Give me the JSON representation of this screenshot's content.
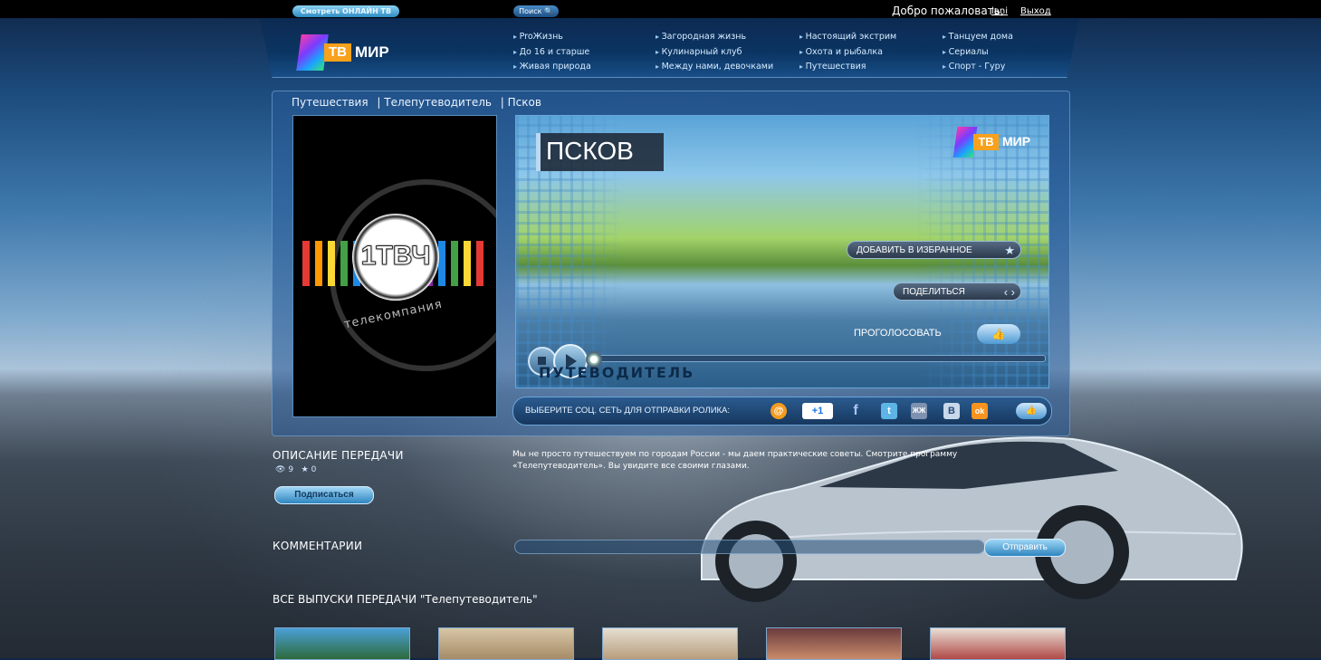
{
  "topbar": {
    "online_tv": "Смотреть ОНЛАЙН ТВ",
    "search": "Поиск 🔍",
    "welcome": "Добро пожаловать,",
    "username": "lani",
    "logout": "Выход"
  },
  "logo": {
    "tv": "ТВ",
    "mir": "МИР"
  },
  "nav": {
    "col1": [
      "ProЖизнь",
      "До 16 и старше",
      "Живая природа"
    ],
    "col2": [
      "Загородная жизнь",
      "Кулинарный клуб",
      "Между нами, девочками"
    ],
    "col3": [
      "Настоящий экстрим",
      "Охота и рыбалка",
      "Путешествия"
    ],
    "col4": [
      "Танцуем дома",
      "Сериалы",
      "Спорт - Гуру"
    ]
  },
  "breadcrumb": [
    "Путешествия",
    "| Телепутеводитель",
    "| Псков"
  ],
  "poster": {
    "channel": "1ТВЧ",
    "subtitle": "телекомпания"
  },
  "player": {
    "title": "ПСКОВ",
    "add_favorite": "ДОБАВИТЬ В ИЗБРАННОЕ",
    "share": "ПОДЕЛИТЬСЯ",
    "vote": "ПРОГОЛОСОВАТЬ",
    "watermark": "ПУТЕВОДИТЕЛЬ"
  },
  "share_bar": {
    "label": "ВЫБЕРИТЕ СОЦ. СЕТЬ ДЛЯ ОТПРАВКИ РОЛИКА:",
    "networks": [
      "@",
      "+1",
      "f",
      "t",
      "ЖЖ",
      "B",
      "ok"
    ]
  },
  "description": {
    "title": "ОПИСАНИЕ ПЕРЕДАЧИ",
    "views": "9",
    "favorites": "0",
    "subscribe": "Подписаться",
    "text": "Мы не просто путешествуем по городам России - мы даем практические советы. Смотрите программу «Телепутеводитель». Вы увидите все своими глазами."
  },
  "comments": {
    "title": "КОММЕНТАРИИ",
    "send": "Отправить"
  },
  "episodes": {
    "title": "ВСЕ ВЫПУСКИ ПЕРЕДАЧИ \"Телепутеводитель\""
  },
  "colors": {
    "accent": "#2f86c0",
    "brand_orange": "#f7a11c"
  }
}
